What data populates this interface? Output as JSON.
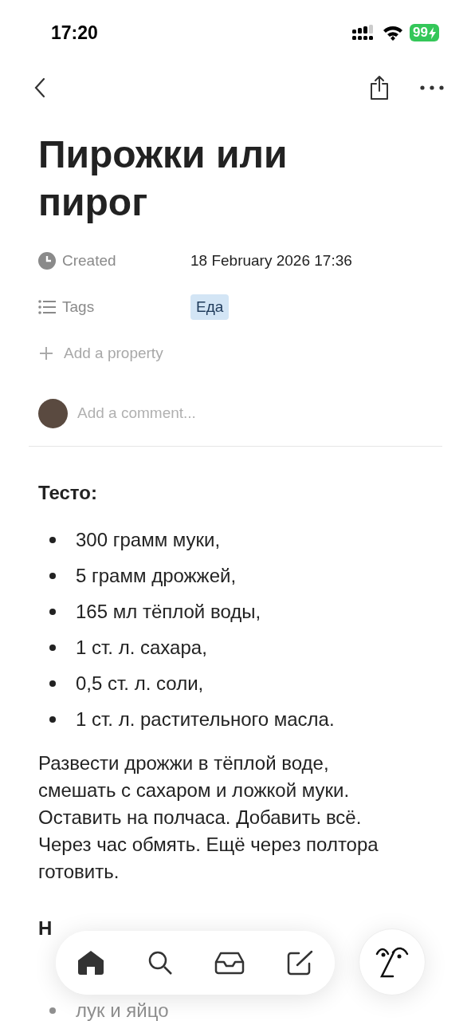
{
  "status_bar": {
    "time": "17:20",
    "battery": "99"
  },
  "page": {
    "title": "Пирожки или пирог",
    "properties": [
      {
        "kind": "date",
        "label": "Created",
        "value": "18 February 2026 17:36"
      },
      {
        "kind": "tags",
        "label": "Tags",
        "tags": [
          {
            "label": "Еда",
            "color": "#d3e5f5"
          }
        ]
      }
    ],
    "add_property": "Add a property",
    "comment_placeholder": "Add a comment...",
    "blocks": [
      {
        "kind": "heading",
        "text": "Тесто:"
      },
      {
        "kind": "bullets",
        "items": [
          "300 грамм муки,",
          "5 грамм дрожжей,",
          "165 мл тёплой воды,",
          "1 ст. л. сахара,",
          "0,5 ст. л. соли,",
          "1 ст. л. растительного масла."
        ]
      },
      {
        "kind": "paragraph",
        "text": "Развести дрожжи в тёплой воде, смешать с сахаром и ложкой муки. Оставить на полчаса. Добавить всё. Через час обмять. Ещё через полтора готовить."
      },
      {
        "kind": "heading",
        "text": "Н"
      },
      {
        "kind": "faded",
        "text": "лук и яйцо"
      }
    ]
  }
}
